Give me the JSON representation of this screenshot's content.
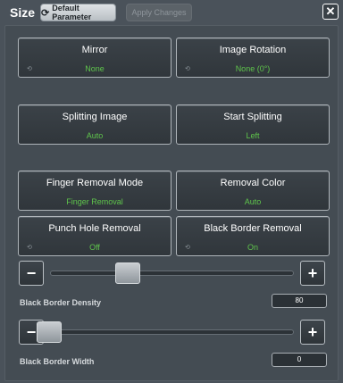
{
  "header": {
    "title": "Size",
    "default_label": "Default Parameter",
    "apply_label": "Apply Changes",
    "close_glyph": "✕"
  },
  "options": [
    {
      "label": "Mirror",
      "value": "None"
    },
    {
      "label": "Image Rotation",
      "value": "None (0°)"
    },
    {
      "label": "Splitting Image",
      "value": "Auto"
    },
    {
      "label": "Start Splitting",
      "value": "Left"
    },
    {
      "label": "Finger Removal Mode",
      "value": "Finger Removal"
    },
    {
      "label": "Removal Color",
      "value": "Auto"
    },
    {
      "label": "Punch Hole Removal",
      "value": "Off"
    },
    {
      "label": "Black Border Removal",
      "value": "On"
    }
  ],
  "density": {
    "label": "Black Border Density",
    "value": "80"
  },
  "width": {
    "label": "Black Border Width",
    "value": "0"
  },
  "glyphs": {
    "minus": "−",
    "plus": "+",
    "refresh": "⟳",
    "cycle": "⟲"
  },
  "colors": {
    "value_green": "#5fc54c",
    "background": "#4a525a"
  }
}
